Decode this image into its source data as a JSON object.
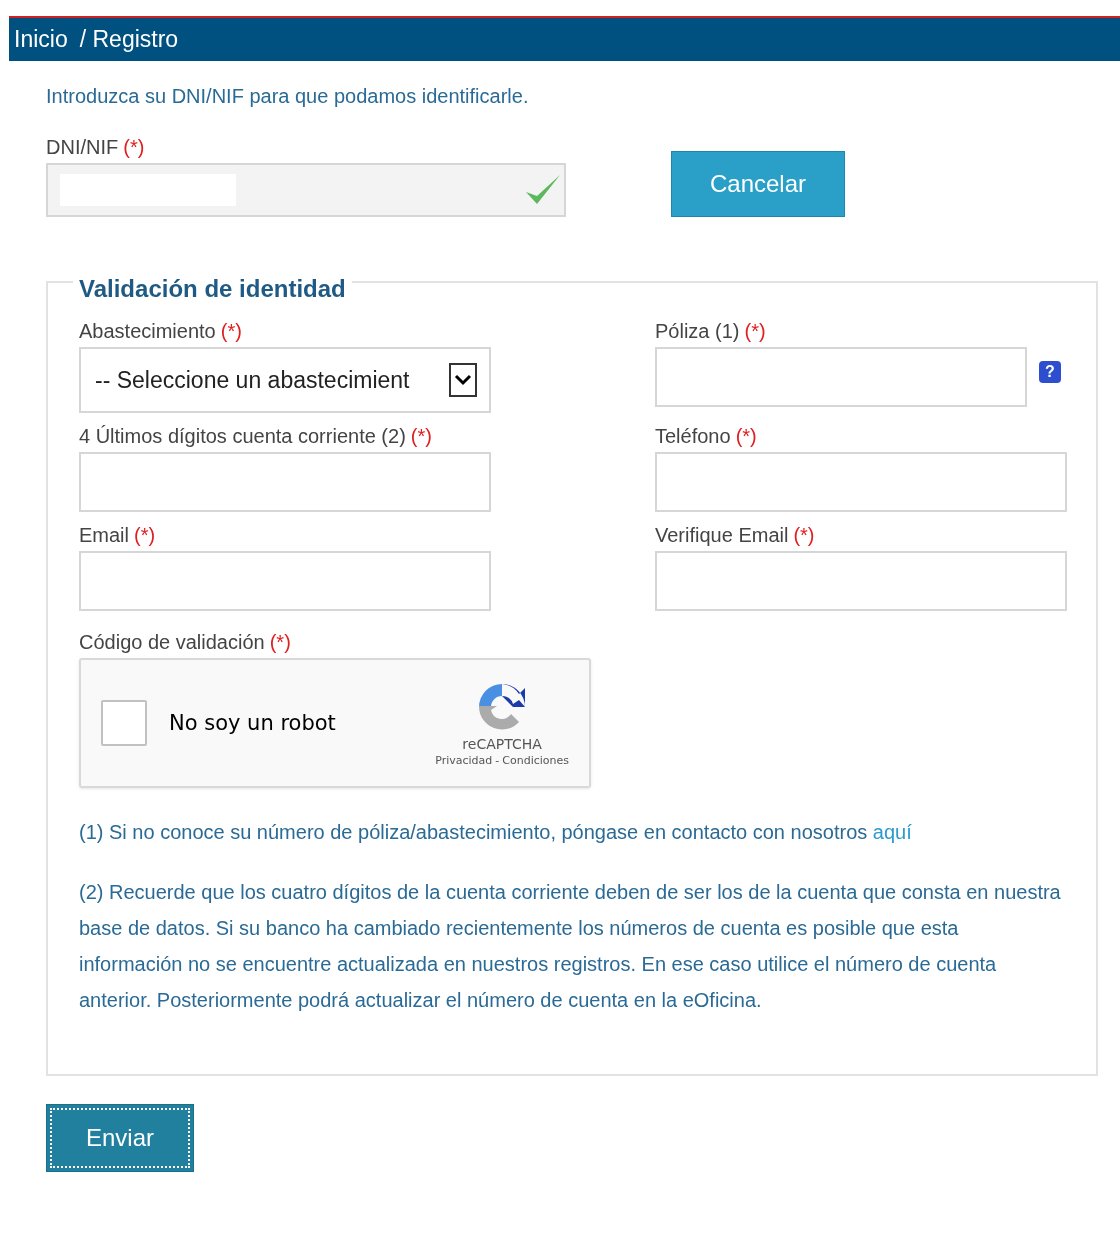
{
  "breadcrumb": {
    "home": "Inicio",
    "current": "/ Registro"
  },
  "intro": "Introduzca su DNI/NIF para que podamos identificarle.",
  "dni": {
    "label": "DNI/NIF",
    "required": "(*)",
    "valid": true,
    "redacted": true
  },
  "cancel_button": "Cancelar",
  "fieldset": {
    "legend": "Validación de identidad",
    "fields": [
      {
        "kind": "select",
        "label": "Abastecimiento",
        "required": "(*)",
        "value": "-- Seleccione un abastecimient"
      },
      {
        "kind": "help",
        "label": "Póliza (1)",
        "required": "(*)",
        "help_icon": "?"
      },
      {
        "kind": "text",
        "label": "4 Últimos dígitos cuenta corriente (2)",
        "required": "(*)"
      },
      {
        "kind": "text",
        "label": "Teléfono",
        "required": "(*)"
      },
      {
        "kind": "text",
        "label": "Email",
        "required": "(*)"
      },
      {
        "kind": "text",
        "label": "Verifique Email",
        "required": "(*)"
      }
    ],
    "captcha": {
      "label": "Código de validación",
      "required": "(*)",
      "checkbox_label": "No soy un robot",
      "checked": false,
      "brand": "reCAPTCHA",
      "privacy": "Privacidad",
      "separator": "-",
      "terms": "Condiciones"
    },
    "note_1": {
      "text": "(1) Si no conoce su número de póliza/abastecimiento, póngase en contacto con nosotros",
      "link": "aquí"
    },
    "note_2": "(2) Recuerde que los cuatro dígitos de la cuenta corriente deben de ser los de la cuenta que consta en nuestra base de datos. Si su banco ha cambiado recientemente los números de cuenta es posible que esta información no se encuentre actualizada en nuestros registros. En ese caso utilice el número de cuenta anterior. Posteriormente podrá actualizar el número de cuenta en la eOficina."
  },
  "submit_button": {
    "label": "Enviar",
    "focused": true
  }
}
